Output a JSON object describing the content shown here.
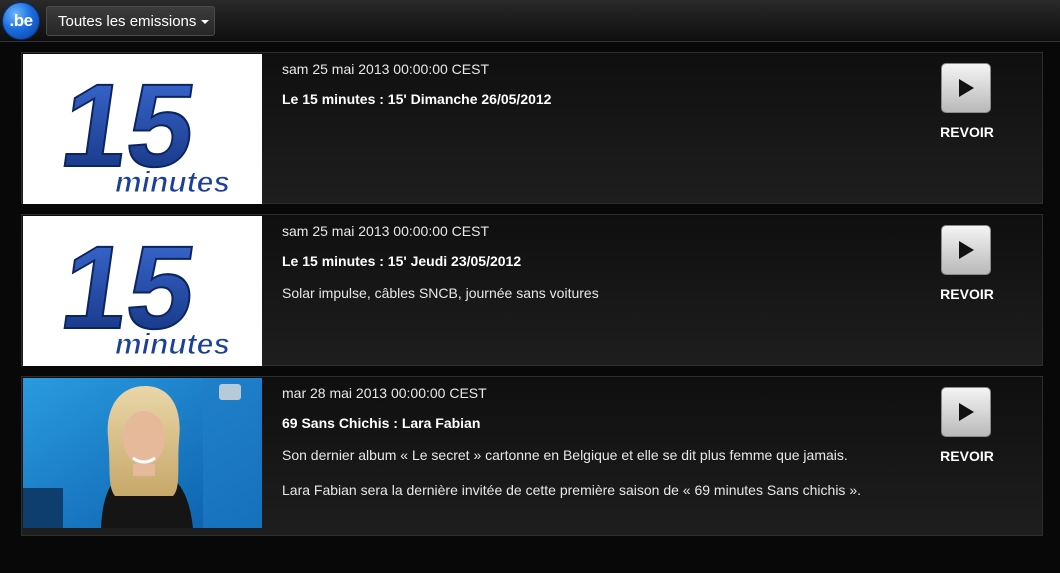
{
  "header": {
    "logo_text": ".be",
    "dropdown_label": "Toutes les emissions"
  },
  "items": [
    {
      "thumbnail": "15-minutes-logo",
      "date": "sam 25 mai 2013 00:00:00 CEST",
      "title": "Le 15 minutes : 15' Dimanche 26/05/2012",
      "description": "",
      "description_extra": "",
      "action_label": "REVOIR"
    },
    {
      "thumbnail": "15-minutes-logo",
      "date": "sam 25 mai 2013 00:00:00 CEST",
      "title": "Le 15 minutes : 15' Jeudi 23/05/2012",
      "description": "Solar impulse, câbles SNCB, journée sans voitures",
      "description_extra": "",
      "action_label": "REVOIR"
    },
    {
      "thumbnail": "tv-presenter-photo",
      "date": "mar 28 mai 2013 00:00:00 CEST",
      "title": "69 Sans Chichis : Lara Fabian",
      "description": "Son dernier album « Le secret » cartonne en Belgique et elle se dit plus femme que jamais.",
      "description_extra": "Lara Fabian sera la dernière invitée de cette première saison de « 69 minutes Sans chichis ».",
      "action_label": "REVOIR"
    }
  ],
  "thumb_logo_text": {
    "number": "15",
    "word": "minutes"
  },
  "colors": {
    "logo_blue": "#1a6fe0",
    "background": "#080808",
    "card": "#1a1a1a"
  }
}
